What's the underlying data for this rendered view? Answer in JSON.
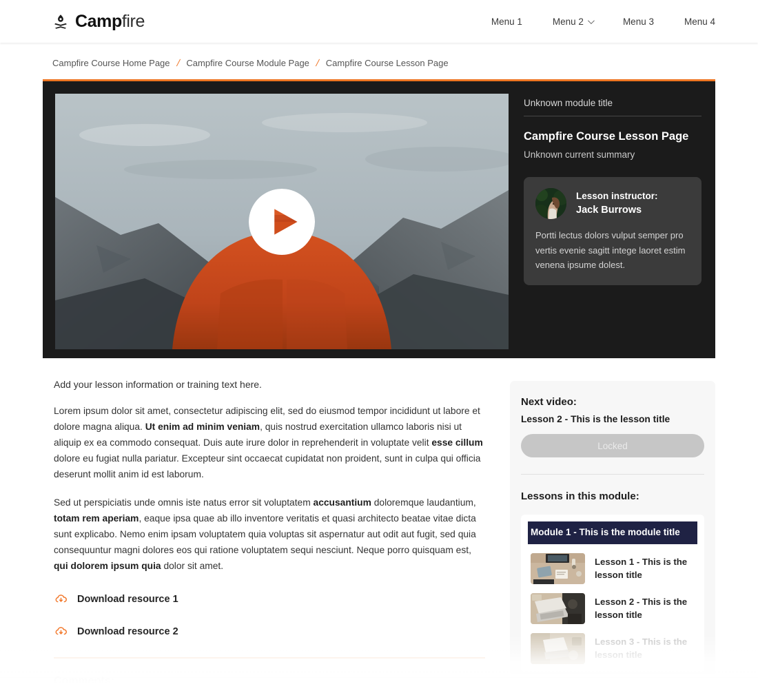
{
  "header": {
    "brand": {
      "bold_part": "Camp",
      "light_part": "fire",
      "icon": "campfire-icon"
    },
    "nav": [
      {
        "label": "Menu 1",
        "has_dropdown": false
      },
      {
        "label": "Menu 2",
        "has_dropdown": true,
        "icon": "chevron-down-icon"
      },
      {
        "label": "Menu 3",
        "has_dropdown": false
      },
      {
        "label": "Menu 4",
        "has_dropdown": false
      }
    ]
  },
  "breadcrumb": {
    "items": [
      "Campfire Course Home Page",
      "Campfire Course Module Page",
      "Campfire Course Lesson Page"
    ],
    "separator": "/"
  },
  "video_panel": {
    "accent_color": "#ee7623",
    "background": "#1b1b1b",
    "player": {
      "icon": "play-icon",
      "poster_description": "Person in orange hoodie and beanie facing a misty mountain valley"
    },
    "side": {
      "module_kicker": "Unknown module title",
      "lesson_heading": "Campfire Course Lesson Page",
      "lesson_summary": "Unknown current summary",
      "instructor": {
        "role_label": "Lesson instructor:",
        "name": "Jack Burrows",
        "bio": "Portti lectus dolors vulput semper pro vertis evenie sagitt intege laoret estim venena ipsume dolest.",
        "avatar": "instructor-avatar"
      }
    }
  },
  "article": {
    "lead": "Add your lesson information or training text here.",
    "paragraph_1": {
      "part_1": "Lorem ipsum dolor sit amet, consectetur adipiscing elit, sed do eiusmod tempor incididunt ut labore et dolore magna aliqua. ",
      "bold_1": "Ut enim ad minim veniam",
      "part_2": ", quis nostrud exercitation ullamco laboris nisi ut aliquip ex ea commodo consequat. Duis aute irure dolor in reprehenderit in voluptate velit ",
      "bold_2": "esse cillum",
      "part_3": " dolore eu fugiat nulla pariatur. Excepteur sint occaecat cupidatat non proident, sunt in culpa qui officia deserunt mollit anim id est laborum."
    },
    "paragraph_2": {
      "part_1": "Sed ut perspiciatis unde omnis iste natus error sit voluptatem ",
      "bold_1": "accusantium",
      "part_2": " doloremque laudantium, ",
      "bold_2": "totam rem aperiam",
      "part_3": ", eaque ipsa quae ab illo inventore veritatis et quasi architecto beatae vitae dicta sunt explicabo. Nemo enim ipsam voluptatem quia voluptas sit aspernatur aut odit aut fugit, sed quia consequuntur magni dolores eos qui ratione voluptatem sequi nesciunt. Neque porro quisquam est, ",
      "bold_3": "qui dolorem ipsum quia",
      "part_4": " dolor sit amet."
    },
    "resources": [
      {
        "label": "Download resource 1",
        "icon": "cloud-download-icon"
      },
      {
        "label": "Download resource 2",
        "icon": "cloud-download-icon"
      }
    ],
    "comments_title": "Comments:"
  },
  "sidebar": {
    "next_video": {
      "title": "Next video:",
      "lesson_title": "Lesson 2 - This is the lesson title",
      "button_label": "Locked"
    },
    "lessons_section_title": "Lessons in this module:",
    "module": {
      "title": "Module 1 - This is the module title",
      "header_color": "#1f2244",
      "lessons": [
        {
          "title": "Lesson 1 - This is the lesson title",
          "thumb": "desk-overhead-thumb",
          "locked": false
        },
        {
          "title": "Lesson 2 - This is the lesson title",
          "thumb": "laptop-desk-thumb",
          "locked": false
        },
        {
          "title": "Lesson 3 - This is the lesson title",
          "thumb": "laptop-light-thumb",
          "locked": true
        }
      ]
    }
  }
}
